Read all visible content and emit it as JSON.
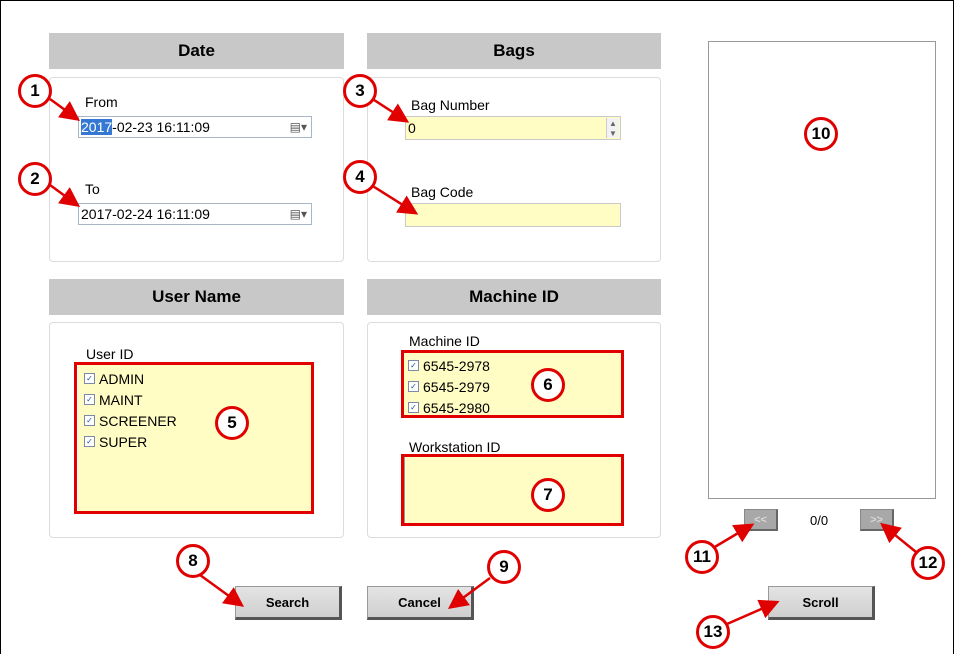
{
  "sections": {
    "date": "Date",
    "bags": "Bags",
    "user_name": "User Name",
    "machine_id": "Machine ID"
  },
  "date": {
    "from_label": "From",
    "from_value_selected": "2017",
    "from_value_rest": "-02-23 16:11:09",
    "to_label": "To",
    "to_value": "2017-02-24 16:11:09"
  },
  "bags": {
    "bag_number_label": "Bag Number",
    "bag_number_value": "0",
    "bag_code_label": "Bag Code",
    "bag_code_value": ""
  },
  "user": {
    "user_id_label": "User ID",
    "users": [
      "ADMIN",
      "MAINT",
      "SCREENER",
      "SUPER"
    ]
  },
  "machine": {
    "machine_id_label": "Machine ID",
    "machines": [
      "6545-2978",
      "6545-2979",
      "6545-2980"
    ],
    "workstation_label": "Workstation ID"
  },
  "buttons": {
    "search": "Search",
    "cancel": "Cancel",
    "scroll": "Scroll",
    "prev": "<<",
    "next": ">>"
  },
  "pager": {
    "count": "0/0"
  },
  "callouts": [
    "1",
    "2",
    "3",
    "4",
    "5",
    "6",
    "7",
    "8",
    "9",
    "10",
    "11",
    "12",
    "13"
  ],
  "colors": {
    "callout": "#e00000",
    "field": "#fffcc4",
    "header": "#c8c8c8"
  }
}
